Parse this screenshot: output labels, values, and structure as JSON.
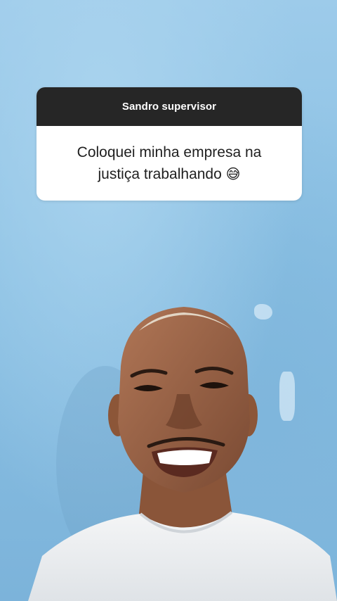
{
  "question_sticker": {
    "sender": "Sandro supervisor",
    "question_line_1": "Coloquei minha empresa na",
    "question_line_2": "justiça trabalhando",
    "emoji": "😅"
  }
}
